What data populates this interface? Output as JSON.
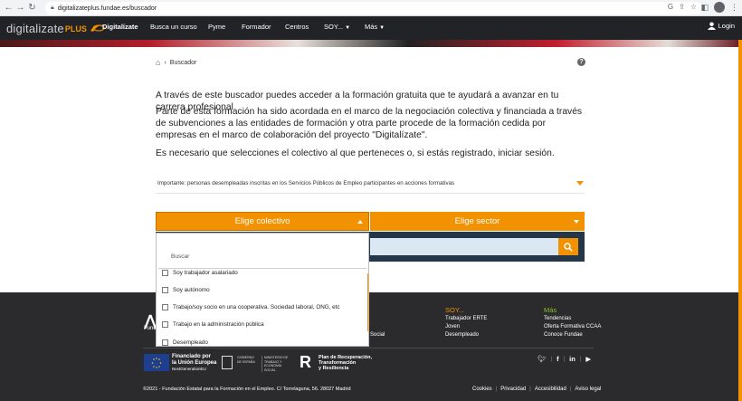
{
  "browser": {
    "url": "digitalizateplus.fundae.es/buscador",
    "profile_initial": "M"
  },
  "nav": {
    "logo_main": "digitalizate",
    "logo_plus": "PLUS",
    "items": [
      {
        "label": "Digitalízate",
        "bold": true
      },
      {
        "label": "Busca un curso"
      },
      {
        "label": "Pyme"
      },
      {
        "label": "Formador"
      },
      {
        "label": "Centros"
      },
      {
        "label": "SOY..."
      },
      {
        "label": "Más"
      }
    ],
    "login": "Login"
  },
  "breadcrumb": {
    "current": "Buscador"
  },
  "intro": {
    "p1": "A través de este buscador puedes acceder a la formación gratuita que te ayudará a avanzar en tu carrera profesional",
    "p2": "Parte de esta formación ha sido acordada en el marco de la negociación colectiva y financiada a través de subvenciones a las entidades de formación y otra parte procede de la formación cedida por empresas en el marco de colaboración del proyecto \"Digitalízate\".",
    "p3": "Es necesario que selecciones el colectivo al que perteneces o, si estás registrado, iniciar sesión."
  },
  "importante": "Importante: personas desempleadas inscritas en los Servicios Públicos de Empleo participantes en acciones formativas",
  "tabs": {
    "colectivo": "Elige colectivo",
    "sector": "Elige sector"
  },
  "dropdown": {
    "search_placeholder": "Buscar",
    "options": [
      "Soy trabajador asalariado",
      "Soy autónomo",
      "Trabajo/soy socio en una cooperativa. Sociedad laboral, ONG, etc",
      "Trabajo en la administración pública",
      "Desempleado"
    ]
  },
  "footer": {
    "logo_fragment": "Fund",
    "social_fragment": "Social",
    "soy": {
      "heading": "SOY...",
      "items": [
        "Trabajador ERTE",
        "Joven",
        "Desempleado"
      ]
    },
    "mas": {
      "heading": "Más",
      "items": [
        "Tendencias",
        "Oferta Formativa CCAA",
        "Conoce Fundae"
      ]
    },
    "eu": {
      "line1": "Financiado por",
      "line2": "la Unión Europea",
      "line3": "NextGenerationEU"
    },
    "gobierno": "GOBIERNO DE ESPAÑA",
    "ministerio": "MINISTERIO DE TRABAJO Y ECONOMÍA SOCIAL",
    "plan": {
      "line1": "Plan de Recuperación,",
      "line2": "Transformación",
      "line3": "y Resiliencia"
    },
    "copyright": "©2021 - Fundación Estatal para la Formación en el Empleo. C/ Torrelaguna, 56. 28027 Madrid",
    "legal": [
      "Cookies",
      "Privacidad",
      "Accesibilidad",
      "Aviso legal"
    ]
  },
  "colors": {
    "accent": "#f39200",
    "nav_bg": "#222327",
    "band_bg": "#24374a",
    "footer_bg": "#2b2b2e"
  }
}
